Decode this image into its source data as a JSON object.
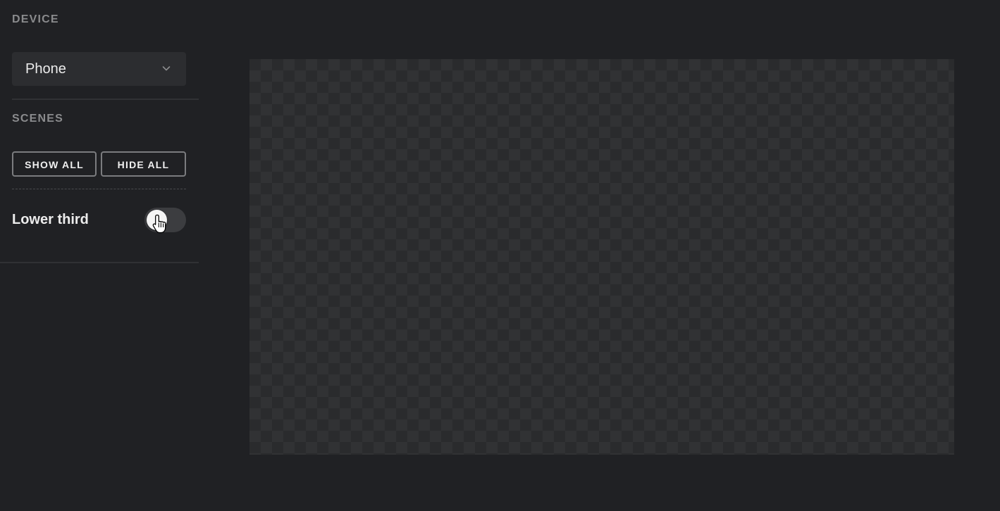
{
  "sidebar": {
    "device": {
      "heading": "DEVICE",
      "select": {
        "value": "Phone",
        "icon": "chevron-down-icon"
      }
    },
    "scenes": {
      "heading": "SCENES",
      "show_all_label": "SHOW ALL",
      "hide_all_label": "HIDE ALL",
      "items": [
        {
          "label": "Lower third",
          "enabled": false
        }
      ]
    }
  },
  "preview": {
    "pattern": "checkerboard"
  },
  "colors": {
    "background": "#202124",
    "panel": "#2c2d30",
    "heading_text": "#8a8b8d",
    "text": "#ececec",
    "button_border": "#7b7c7f",
    "toggle_track": "#3c3d40",
    "toggle_knob": "#f4f4f4"
  },
  "cursor": {
    "icon": "hand-pointer-icon"
  }
}
